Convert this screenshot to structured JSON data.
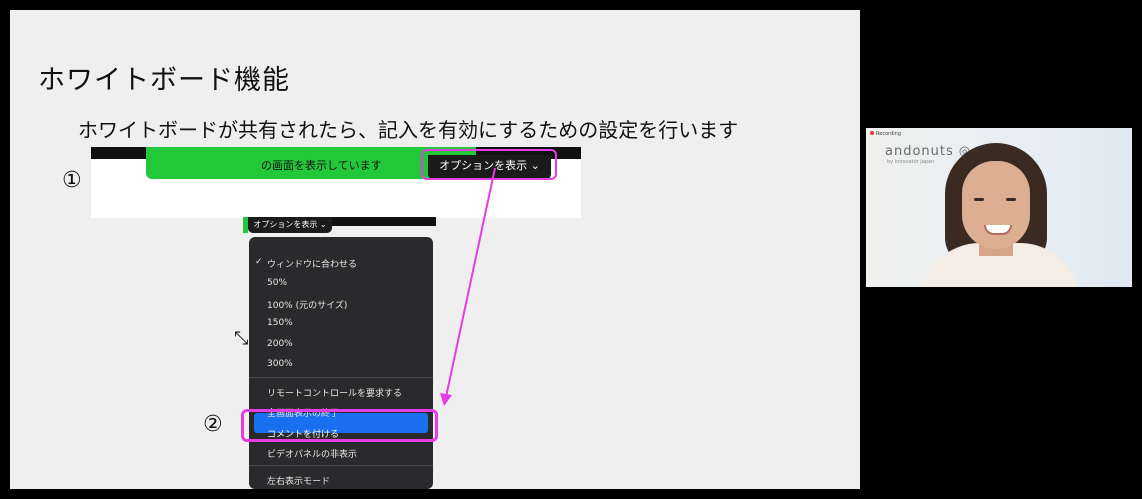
{
  "slide": {
    "title": "ホワイトボード機能",
    "subtitle": "ホワイトボードが共有されたら、記入を有効にするための設定を行います",
    "step1_marker": "①",
    "step2_marker": "②",
    "shot1": {
      "share_banner_text": "の画面を表示しています",
      "options_button_label": "オプションを表示 ⌄"
    },
    "shot2": {
      "options_button_label": "オプションを表示 ⌄",
      "menu_items": [
        {
          "label": "ウィンドウに合わせる",
          "checked": true
        },
        {
          "label": "50%"
        },
        {
          "label": "100% (元のサイズ)"
        },
        {
          "label": "150%"
        },
        {
          "label": "200%"
        },
        {
          "label": "300%"
        },
        {
          "label": "リモートコントロールを要求する"
        },
        {
          "label": "全画面表示の終了"
        },
        {
          "label": "コメントを付ける",
          "selected": true
        },
        {
          "label": "ビデオパネルの非表示"
        },
        {
          "label": "左右表示モード"
        }
      ]
    },
    "highlight_color": "#e63ce6",
    "selection_color": "#1a6ef0",
    "cursor_icon": "resize-cursor-icon"
  },
  "camera": {
    "recording_label": "Recording",
    "brand_name": "andonuts",
    "brand_sub": "by Innovator Japan"
  }
}
